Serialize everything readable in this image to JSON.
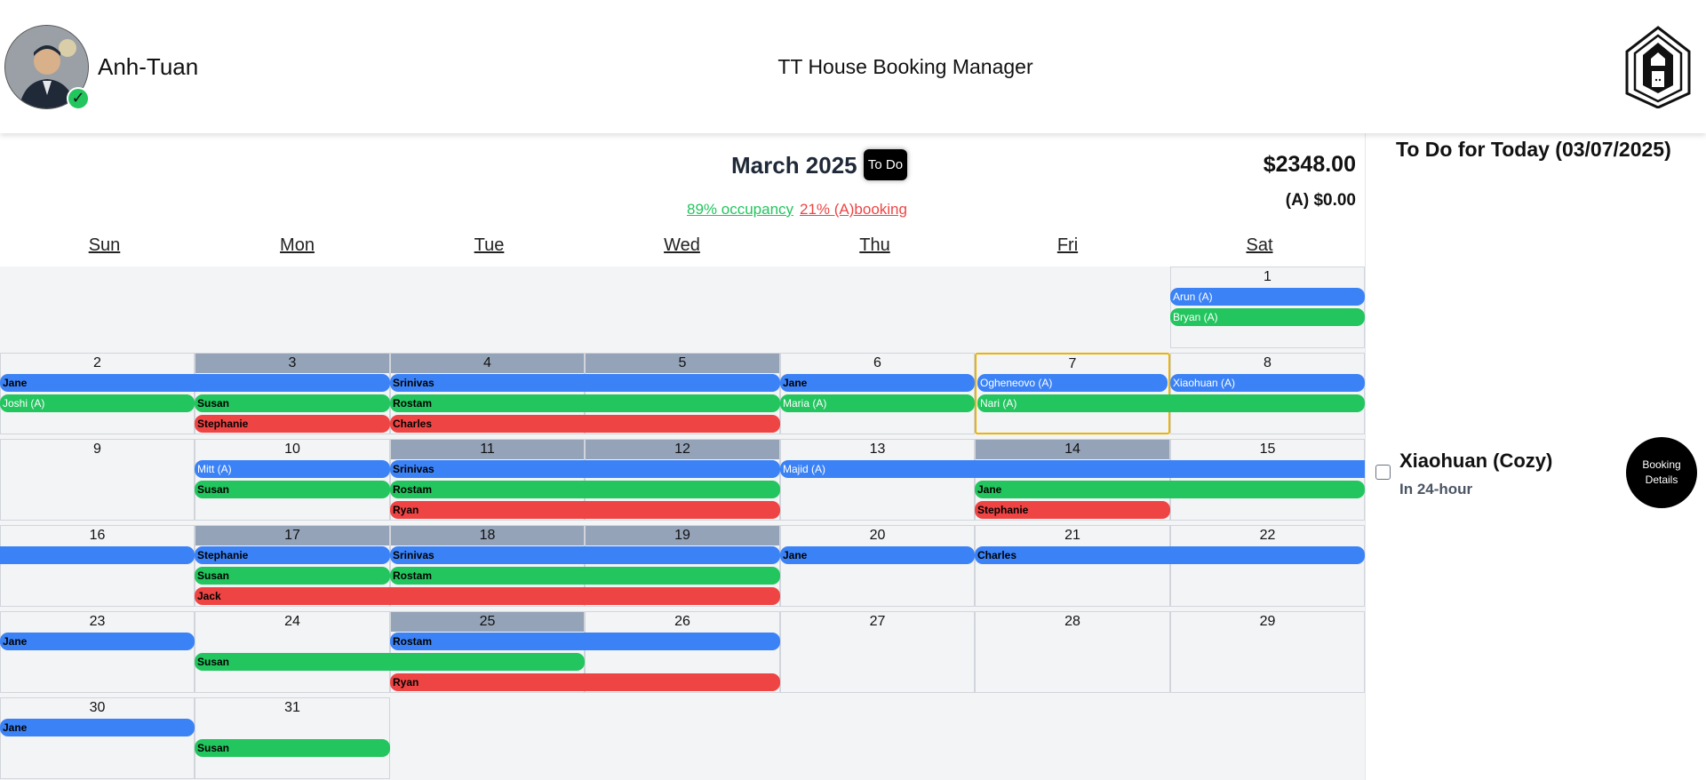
{
  "header": {
    "username": "Anh-Tuan",
    "title": "TT House Booking Manager",
    "status_icon": "check-icon",
    "logo_icon": "house-logo-icon"
  },
  "calendar": {
    "month_title": "March 2025",
    "todo_button": "To Do",
    "total": "$2348.00",
    "a_total": "(A) $0.00",
    "occupancy": "89% occupancy",
    "a_booking": "21% (A)booking",
    "weekdays": [
      "Sun",
      "Mon",
      "Tue",
      "Wed",
      "Thu",
      "Fri",
      "Sat"
    ],
    "days": [
      "1",
      "2",
      "3",
      "4",
      "5",
      "6",
      "7",
      "8",
      "9",
      "10",
      "11",
      "12",
      "13",
      "14",
      "15",
      "16",
      "17",
      "18",
      "19",
      "20",
      "21",
      "22",
      "23",
      "24",
      "25",
      "26",
      "27",
      "28",
      "29",
      "30",
      "31"
    ],
    "bookings": [
      {
        "name": "Arun (A)",
        "color": "blue",
        "tone": "light"
      },
      {
        "name": "Bryan (A)",
        "color": "green",
        "tone": "light"
      },
      {
        "name": "Jane",
        "color": "blue",
        "tone": "dark"
      },
      {
        "name": "Joshi (A)",
        "color": "green",
        "tone": "light"
      },
      {
        "name": "Susan",
        "color": "green",
        "tone": "dark"
      },
      {
        "name": "Stephanie",
        "color": "red",
        "tone": "dark"
      },
      {
        "name": "Srinivas",
        "color": "blue",
        "tone": "dark"
      },
      {
        "name": "Rostam",
        "color": "green",
        "tone": "dark"
      },
      {
        "name": "Charles",
        "color": "red",
        "tone": "dark"
      },
      {
        "name": "Jane",
        "color": "blue",
        "tone": "dark"
      },
      {
        "name": "Maria (A)",
        "color": "green",
        "tone": "light"
      },
      {
        "name": "Ogheneovo (A)",
        "color": "blue",
        "tone": "light"
      },
      {
        "name": "Nari (A)",
        "color": "green",
        "tone": "light"
      },
      {
        "name": "Xiaohuan (A)",
        "color": "blue",
        "tone": "light"
      },
      {
        "name": "Mitt (A)",
        "color": "blue",
        "tone": "light"
      },
      {
        "name": "Susan",
        "color": "green",
        "tone": "dark"
      },
      {
        "name": "Srinivas",
        "color": "blue",
        "tone": "dark"
      },
      {
        "name": "Rostam",
        "color": "green",
        "tone": "dark"
      },
      {
        "name": "Ryan",
        "color": "red",
        "tone": "dark"
      },
      {
        "name": "Majid (A)",
        "color": "blue",
        "tone": "light"
      },
      {
        "name": "Jane",
        "color": "green",
        "tone": "dark"
      },
      {
        "name": "Stephanie",
        "color": "red",
        "tone": "dark"
      },
      {
        "name": "",
        "color": "blue",
        "tone": "dark"
      },
      {
        "name": "Stephanie",
        "color": "blue",
        "tone": "dark"
      },
      {
        "name": "Susan",
        "color": "green",
        "tone": "dark"
      },
      {
        "name": "Jack",
        "color": "red",
        "tone": "dark"
      },
      {
        "name": "Srinivas",
        "color": "blue",
        "tone": "dark"
      },
      {
        "name": "Rostam",
        "color": "green",
        "tone": "dark"
      },
      {
        "name": "Jane",
        "color": "blue",
        "tone": "dark"
      },
      {
        "name": "Charles",
        "color": "blue",
        "tone": "dark"
      },
      {
        "name": "Jane",
        "color": "blue",
        "tone": "dark"
      },
      {
        "name": "Rostam",
        "color": "blue",
        "tone": "dark"
      },
      {
        "name": "Susan",
        "color": "green",
        "tone": "dark"
      },
      {
        "name": "Ryan",
        "color": "red",
        "tone": "dark"
      },
      {
        "name": "Jane",
        "color": "blue",
        "tone": "dark"
      },
      {
        "name": "Susan",
        "color": "green",
        "tone": "dark"
      }
    ]
  },
  "todo": {
    "title": "To Do for Today (03/07/2025)",
    "item_name": "Xiaohuan (Cozy)",
    "item_sub": "In 24-hour",
    "details_button": "Booking Details"
  },
  "colors": {
    "blue": "#3b82f6",
    "green": "#22c55e",
    "red": "#ef4444",
    "shaded_header": "#94a3b8",
    "today_border": "#eab308"
  }
}
